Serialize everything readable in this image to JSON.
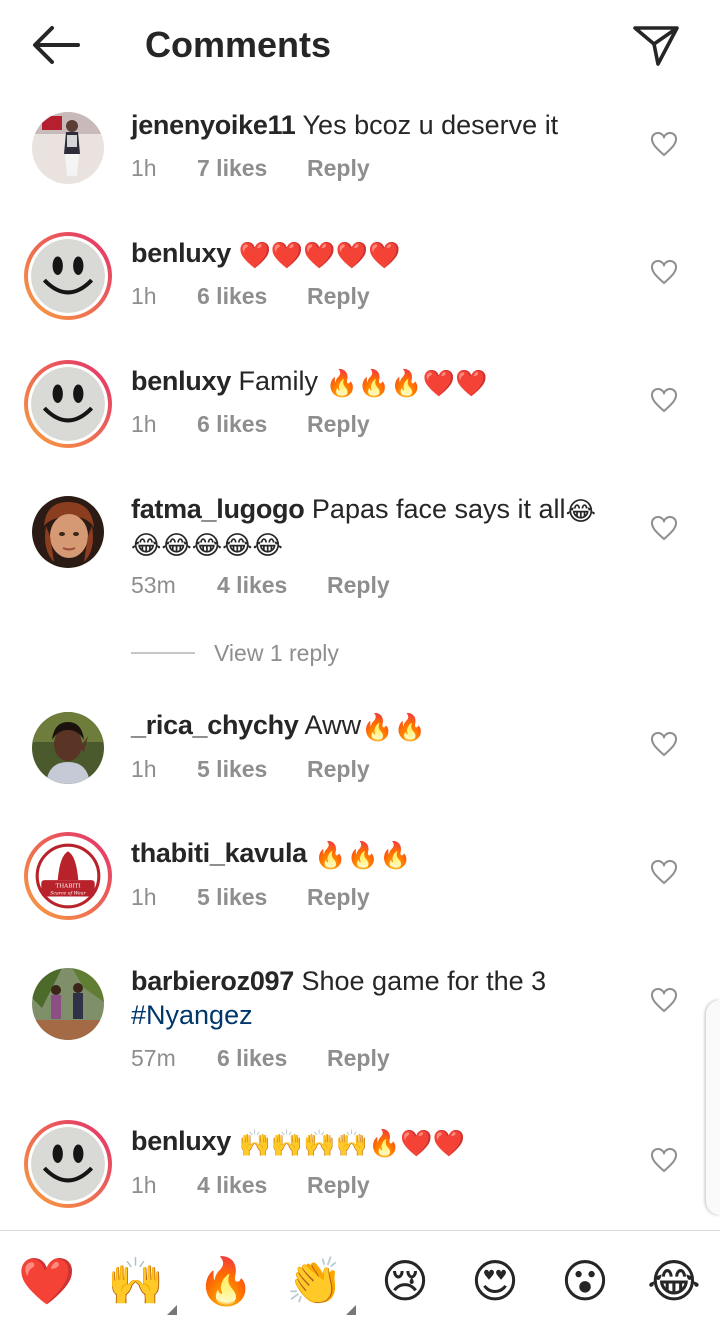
{
  "header": {
    "title": "Comments",
    "back_icon": "arrow-left-icon",
    "share_icon": "paper-plane-icon"
  },
  "comments": [
    {
      "username": "jenenyoike11",
      "text": "Yes bcoz u deserve it",
      "emojis": "",
      "time": "1h",
      "likes": "7 likes",
      "reply": "Reply"
    },
    {
      "username": "benluxy",
      "text": "",
      "emojis": "❤️❤️❤️❤️❤️",
      "time": "1h",
      "likes": "6 likes",
      "reply": "Reply"
    },
    {
      "username": "benluxy",
      "text": "Family",
      "emojis": "🔥🔥🔥❤️❤️",
      "time": "1h",
      "likes": "6 likes",
      "reply": "Reply"
    },
    {
      "username": "fatma_lugogo",
      "text": "Papas face says it all",
      "emojis": "😂",
      "emojis_line2": "😂😂😂😂😂",
      "time": "53m",
      "likes": "4 likes",
      "reply": "Reply"
    },
    {
      "username": "_rica_chychy",
      "text": "Aww",
      "emojis": "🔥🔥",
      "time": "1h",
      "likes": "5 likes",
      "reply": "Reply"
    },
    {
      "username": "thabiti_kavula",
      "text": "",
      "emojis": "🔥🔥🔥",
      "time": "1h",
      "likes": "5 likes",
      "reply": "Reply"
    },
    {
      "username": "barbieroz097",
      "text": "Shoe game for the 3",
      "hashtag": "#Nyangez",
      "time": "57m",
      "likes": "6 likes",
      "reply": "Reply"
    },
    {
      "username": "benluxy",
      "text": "",
      "emojis": "🙌🙌🙌🙌🔥❤️❤️",
      "time": "1h",
      "likes": "4 likes",
      "reply": "Reply"
    }
  ],
  "view_replies": {
    "label": "View 1 reply"
  },
  "avatar_badges": {
    "thabiti_line1": "THABITI",
    "thabiti_line2": "Scarce of Wear"
  },
  "reactions": [
    {
      "emoji": "❤️",
      "icon": "red-heart-icon"
    },
    {
      "emoji": "🙌",
      "icon": "raising-hands-icon"
    },
    {
      "emoji": "🔥",
      "icon": "fire-icon"
    },
    {
      "emoji": "👏",
      "icon": "clapping-hands-icon"
    },
    {
      "emoji": "😢",
      "icon": "crying-face-icon"
    },
    {
      "emoji": "😍",
      "icon": "heart-eyes-icon"
    },
    {
      "emoji": "😮",
      "icon": "surprised-face-icon"
    },
    {
      "emoji": "😂",
      "icon": "tears-of-joy-icon"
    }
  ],
  "colors": {
    "text": "#262626",
    "meta": "#8e8e8e",
    "hashtag": "#00376b",
    "story_ring_start": "#f9a03f",
    "story_ring_end": "#e1306c"
  }
}
